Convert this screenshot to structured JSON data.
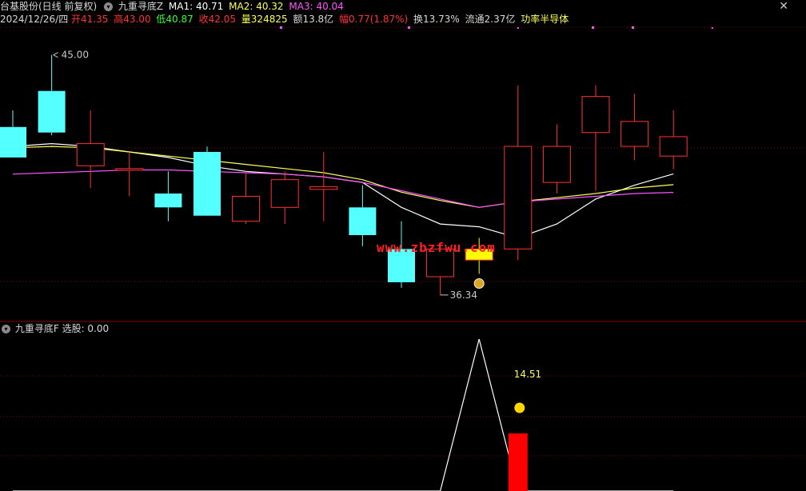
{
  "header": {
    "stock_name": "台基股份(日线 前复权)",
    "indicator_name": "九重寻底Z",
    "ma1_label": "MA1: 40.71",
    "ma2_label": "MA2: 40.32",
    "ma3_label": "MA3: 40.04",
    "date": "2024/12/26/四",
    "open": "开41.35",
    "high": "高43.00",
    "low": "低40.87",
    "close": "收42.05",
    "volume": "量324825",
    "amount": "额13.8亿",
    "change": "幅0.77(1.87%)",
    "turnover": "换13.73%",
    "float_cap": "流通2.37亿",
    "sector": "功率半导体",
    "close_icon": "close-icon"
  },
  "sub_panel": {
    "indicator_name": "九重寻底F",
    "value_label": "选股: 0.00",
    "annotation": "14.51",
    "smile_icon": "smiley-icon"
  },
  "watermark": "www.zbzfwu.com",
  "colors": {
    "up": "#ff3232",
    "down": "#54ffff",
    "ma1": "#ffffff",
    "ma2": "#ffff54",
    "ma3": "#ff54ff",
    "signal_candle": "#ffff00",
    "volume_bar": "#ff0000",
    "grid": "#8b0000"
  },
  "chart_data": [
    {
      "type": "candlestick",
      "title": "台基股份(日线 前复权)",
      "ylim": [
        35.5,
        46.0
      ],
      "grid": true,
      "annotations": [
        {
          "label": "45.00",
          "at_candle": 1,
          "value": 45.0,
          "kind": "high"
        },
        {
          "label": "36.34",
          "at_candle": 11,
          "value": 36.34,
          "kind": "low"
        },
        {
          "label": "money-bag-icon",
          "at_candle": 12,
          "kind": "signal"
        }
      ],
      "candles": [
        {
          "o": 42.4,
          "h": 43.0,
          "l": 41.3,
          "c": 41.3
        },
        {
          "o": 43.7,
          "h": 45.0,
          "l": 42.1,
          "c": 42.2
        },
        {
          "o": 41.0,
          "h": 43.0,
          "l": 40.2,
          "c": 41.8
        },
        {
          "o": 40.9,
          "h": 41.5,
          "l": 39.9,
          "c": 40.9
        },
        {
          "o": 40.0,
          "h": 40.8,
          "l": 39.0,
          "c": 39.5
        },
        {
          "o": 41.5,
          "h": 41.7,
          "l": 39.2,
          "c": 39.2
        },
        {
          "o": 39.0,
          "h": 40.8,
          "l": 38.9,
          "c": 39.9
        },
        {
          "o": 39.5,
          "h": 40.8,
          "l": 38.9,
          "c": 40.5
        },
        {
          "o": 40.15,
          "h": 41.5,
          "l": 39.0,
          "c": 40.25
        },
        {
          "o": 39.5,
          "h": 40.3,
          "l": 38.1,
          "c": 38.5
        },
        {
          "o": 38.0,
          "h": 39.0,
          "l": 36.6,
          "c": 36.8
        },
        {
          "o": 37.0,
          "h": 38.2,
          "l": 36.34,
          "c": 38.0
        },
        {
          "o": 37.6,
          "h": 38.4,
          "l": 37.1,
          "c": 38.0
        },
        {
          "o": 38.0,
          "h": 43.9,
          "l": 37.6,
          "c": 41.7
        },
        {
          "o": 40.4,
          "h": 42.5,
          "l": 40.0,
          "c": 41.7
        },
        {
          "o": 42.2,
          "h": 43.9,
          "l": 40.1,
          "c": 43.5
        },
        {
          "o": 41.7,
          "h": 43.6,
          "l": 41.2,
          "c": 42.6
        },
        {
          "o": 41.35,
          "h": 43.0,
          "l": 40.87,
          "c": 42.05
        }
      ],
      "series": [
        {
          "name": "MA1",
          "values": [
            41.7,
            41.8,
            41.7,
            41.5,
            41.3,
            41.0,
            40.8,
            40.7,
            40.6,
            40.4,
            39.5,
            38.9,
            38.8,
            38.4,
            38.9,
            39.8,
            40.3,
            40.71
          ]
        },
        {
          "name": "MA2",
          "values": [
            41.65,
            41.7,
            41.65,
            41.5,
            41.35,
            41.2,
            41.05,
            40.9,
            40.75,
            40.5,
            40.05,
            39.75,
            39.5,
            39.7,
            39.85,
            40.0,
            40.2,
            40.32
          ]
        },
        {
          "name": "MA3",
          "values": [
            40.7,
            40.75,
            40.8,
            40.85,
            40.85,
            40.8,
            40.75,
            40.7,
            40.6,
            40.4,
            40.1,
            39.8,
            39.5,
            39.7,
            39.8,
            39.9,
            40.0,
            40.04
          ]
        }
      ]
    },
    {
      "type": "line",
      "title": "九重寻底F",
      "ylim": [
        0,
        14.51
      ],
      "series": [
        {
          "name": "选股",
          "values": [
            0,
            0,
            0,
            0,
            0,
            0,
            0,
            0,
            0,
            0,
            0,
            0,
            14.51,
            0,
            0,
            0,
            0,
            0
          ]
        }
      ],
      "bars": [
        {
          "at_candle": 13,
          "value": 5.5
        }
      ]
    }
  ]
}
